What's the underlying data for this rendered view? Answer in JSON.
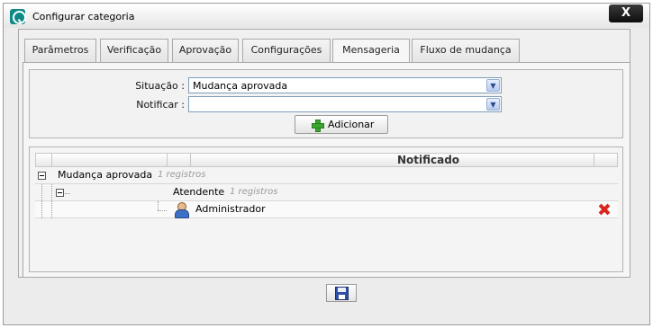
{
  "window": {
    "title": "Configurar categoria",
    "close_label": "X"
  },
  "tabs": [
    {
      "label": "Parâmetros",
      "active": false
    },
    {
      "label": "Verificação",
      "active": false
    },
    {
      "label": "Aprovação",
      "active": false
    },
    {
      "label": "Configurações",
      "active": false
    },
    {
      "label": "Mensageria",
      "active": true
    },
    {
      "label": "Fluxo de mudança",
      "active": false
    }
  ],
  "form": {
    "situacao_label": "Situação :",
    "situacao_value": "Mudança aprovada",
    "notificar_label": "Notificar :",
    "notificar_value": "",
    "add_button_label": "Adicionar"
  },
  "grid": {
    "header": "Notificado",
    "group": {
      "label": "Mudança aprovada",
      "count": "1 registros"
    },
    "subgroup": {
      "label": "Atendente",
      "count": "1 registros"
    },
    "rows": [
      {
        "name": "Administrador"
      }
    ]
  },
  "colors": {
    "tab_border": "#a8a8a8",
    "delete": "#d8261c",
    "add": "#3aa52f",
    "save": "#2f4fa8"
  },
  "icons": {
    "app": "q-search-icon",
    "add": "plus-icon",
    "user": "user-icon",
    "delete": "delete-x-icon",
    "save": "floppy-disk-icon",
    "group_toggle": "collapse-minus-icon"
  }
}
